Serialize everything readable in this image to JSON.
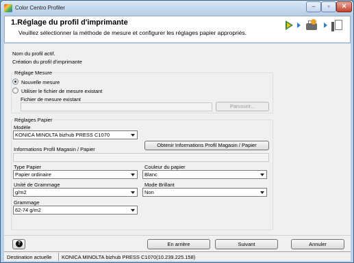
{
  "window": {
    "title": "Color Centro Profiler"
  },
  "header": {
    "title": "1.Réglage du profil d'imprimante",
    "subtitle": "Veuillez sélectionner la méthode de mesure et configurer les réglages papier appropriés.",
    "step_icons": [
      "start-step-icon",
      "printer-step-icon",
      "measure-step-icon"
    ]
  },
  "profile": {
    "name_label": "Nom du profil actif.",
    "name_value": "Création du profil d'imprimante"
  },
  "measure_settings": {
    "group_label": "Réglage Mesure",
    "option_new": "Nouvelle mesure",
    "option_existing": "Utiliser le fichier de mesure existant",
    "selected": "Nouvelle mesure",
    "file_label": "Fichier de mesure existant",
    "file_value": "",
    "browse_label": "Parcourir..."
  },
  "paper_settings": {
    "group_label": "Réglages Papier",
    "model_label": "Modèle",
    "model_value": "KONICA MINOLTA bizhub PRESS C1070",
    "tray_info_label": "Informations Profil Magasin / Papier",
    "tray_info_value": "",
    "get_tray_info_label": "Obtenir Informations Profil Magasin / Papier",
    "paper_type_label": "Type Papier",
    "paper_type_value": "Papier ordinaire",
    "paper_color_label": "Couleur du papier",
    "paper_color_value": "Blanc",
    "weight_unit_label": "Unité de Grammage",
    "weight_unit_value": "g/m2",
    "glossy_mode_label": "Mode Brillant",
    "glossy_mode_value": "Non",
    "weight_label": "Grammage",
    "weight_value": "62-74 g/m2"
  },
  "footer": {
    "back_label": "En arrière",
    "next_label": "Suivant",
    "cancel_label": "Annuler"
  },
  "status": {
    "destination_label": "Destination actuelle",
    "destination_value": "KONICA MINOLTA bizhub PRESS C1070(10.239.225.158)"
  }
}
